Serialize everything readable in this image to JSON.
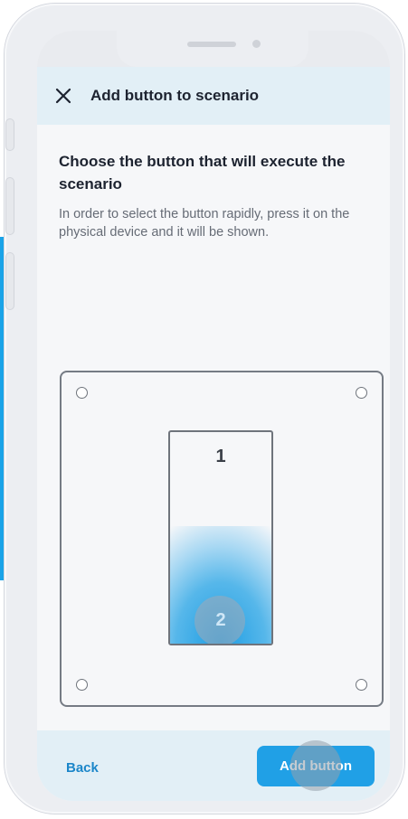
{
  "header": {
    "title": "Add button to scenario",
    "close_icon": "close-icon"
  },
  "content": {
    "heading": "Choose the button that will execute the scenario",
    "description": "In order to select the button rapidly, press it on the physical device and it will be shown."
  },
  "device": {
    "buttons": [
      {
        "label": "1",
        "selected": false
      },
      {
        "label": "2",
        "selected": true
      }
    ],
    "highlight_color": "#1e9de3"
  },
  "footer": {
    "back_label": "Back",
    "add_label": "Add button",
    "accent_color": "#20a0e6"
  }
}
